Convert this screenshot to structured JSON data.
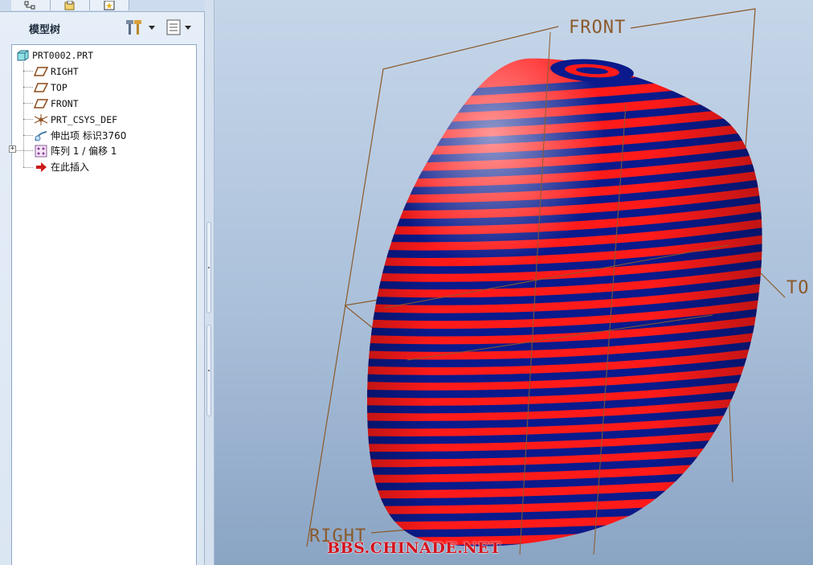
{
  "model_tree": {
    "title": "模型树",
    "items": [
      {
        "label": "PRT0002.PRT",
        "icon": "part-icon"
      },
      {
        "label": "RIGHT",
        "icon": "datum-plane-icon"
      },
      {
        "label": "TOP",
        "icon": "datum-plane-icon"
      },
      {
        "label": "FRONT",
        "icon": "datum-plane-icon"
      },
      {
        "label": "PRT_CSYS_DEF",
        "icon": "coordinate-system-icon"
      },
      {
        "label": "伸出项 标识3760",
        "icon": "protrusion-icon"
      },
      {
        "label": "阵列 1 / 偏移 1",
        "icon": "pattern-icon"
      },
      {
        "label": "在此插入",
        "icon": "insert-here-arrow-icon"
      }
    ]
  },
  "viewport": {
    "planes": {
      "front": "FRONT",
      "top": "TO",
      "right": "RIGHT"
    },
    "watermark": "BBS.CHINADE.NET",
    "colors": {
      "stripe_red": "#ff1a1a",
      "stripe_blue": "#0a1a8c",
      "datum_line": "#8b5a2b",
      "watermark": "#d4131d"
    }
  }
}
